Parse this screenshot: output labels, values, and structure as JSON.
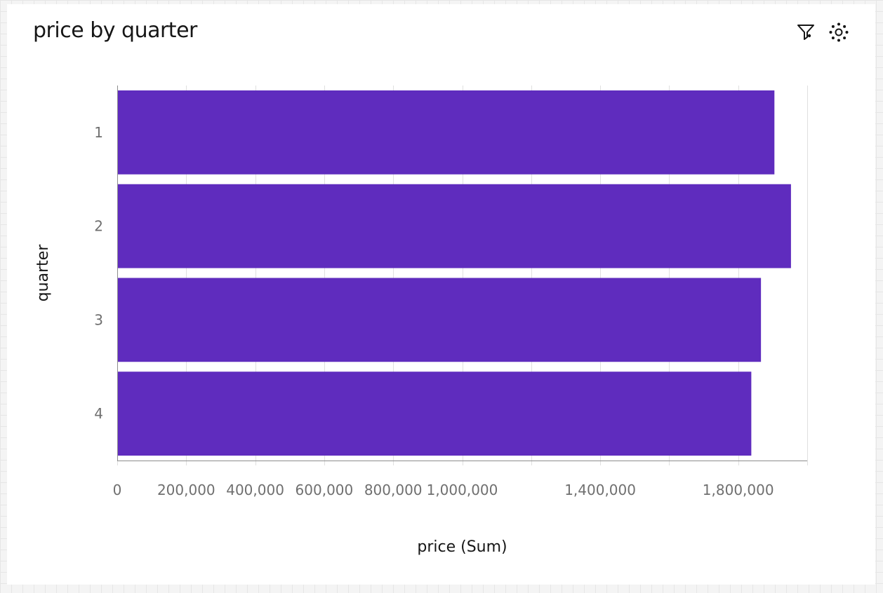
{
  "card": {
    "title": "price by quarter",
    "actions": [
      {
        "icon": "filter-icon",
        "label": "Filter"
      },
      {
        "icon": "settings-icon",
        "label": "Settings"
      }
    ]
  },
  "chart_data": {
    "type": "bar",
    "orientation": "horizontal",
    "title": "price by quarter",
    "categories": [
      "1",
      "2",
      "3",
      "4"
    ],
    "values": [
      1905000,
      1953000,
      1866000,
      1838000
    ],
    "xlabel": "price (Sum)",
    "ylabel": "quarter",
    "xlim": [
      0,
      2000000
    ],
    "x_tick_labels": [
      {
        "value": 0,
        "label": "0"
      },
      {
        "value": 200000,
        "label": "200,000"
      },
      {
        "value": 400000,
        "label": "400,000"
      },
      {
        "value": 600000,
        "label": "600,000"
      },
      {
        "value": 800000,
        "label": "800,000"
      },
      {
        "value": 1000000,
        "label": "1,000,000"
      },
      {
        "value": 1400000,
        "label": "1,400,000"
      },
      {
        "value": 1800000,
        "label": "1,800,000"
      }
    ],
    "gridlines": [
      0,
      200000,
      400000,
      600000,
      800000,
      1000000,
      1200000,
      1400000,
      1600000,
      1800000,
      2000000
    ],
    "grid": true,
    "legend": "none",
    "bar_color": "#5f2cbe"
  }
}
